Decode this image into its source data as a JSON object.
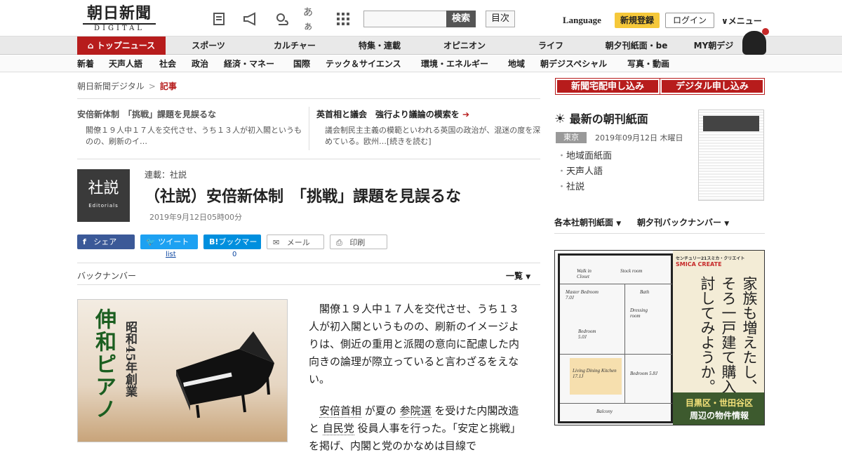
{
  "header": {
    "logo_main": "朝日新聞",
    "logo_sub": "DIGITAL",
    "search_button": "検索",
    "index_button": "目次",
    "language": "Language",
    "signup": "新規登録",
    "login": "ログイン",
    "menu": "∨メニュー",
    "icon_kana": "あぁ"
  },
  "nav_primary": {
    "items": [
      "トップニュース",
      "スポーツ",
      "カルチャー",
      "特集・連載",
      "オピニオン",
      "ライフ",
      "朝夕刊紙面・be",
      "MY朝デジ"
    ]
  },
  "nav_secondary": {
    "items": [
      "新着",
      "天声人語",
      "社会",
      "政治",
      "経済・マネー",
      "国際",
      "テック＆サイエンス",
      "環境・エネルギー",
      "地域",
      "朝デジスペシャル",
      "写真・動画"
    ]
  },
  "breadcrumb": {
    "home": "朝日新聞デジタル",
    "sep": ">",
    "current": "記事"
  },
  "related": [
    {
      "title": "安倍新体制　「挑戦」課題を見誤るな",
      "body": "閣僚１９人中１７人を交代させ、うち１３人が初入閣というものの、刷新のイ…"
    },
    {
      "title": "英首相と議会　強行より議論の模索を",
      "body": "議会制民主主義の模範といわれる英国の政治が、混迷の度を深めている。欧州…[続きを読む]"
    }
  ],
  "article": {
    "thumb_kanji": "社説",
    "thumb_en": "Editorials",
    "series": "連載：社説",
    "headline": "（社説）安倍新体制　「挑戦」課題を見誤るな",
    "date": "2019年9月12日05時00分",
    "share": {
      "facebook": "シェア",
      "twitter": "ツイート",
      "hatena": "ブックマーク",
      "hatena_logo": "B!",
      "mail": "メール",
      "print": "印刷",
      "twitter_count": "list",
      "hatena_count": "0"
    },
    "backnumber": "バックナンバー",
    "list_all": "一覧",
    "p1": "閣僚１９人中１７人を交代させ、うち１３人が初入閣というものの、刷新のイメージよりは、側近の重用と派閥の意向に配慮した内向きの論理が際立っていると言わざるをえない。",
    "p2_a": "安倍首相",
    "p2_b": "が夏の",
    "p2_c": "参院選",
    "p2_d": "を受けた内閣改造と",
    "p2_e": "自民党",
    "p2_f": "役員人事を行った。「安定と挑戦」を掲げ、内閣と党のかなめは目線で"
  },
  "ad_piano": {
    "name": "伸和ピアノ",
    "est": "昭和45年創業"
  },
  "sidebar": {
    "apply_home": "新聞宅配申し込み",
    "apply_digital": "デジタル申し込み",
    "paper_heading": "最新の朝刊紙面",
    "paper_place": "東京",
    "paper_date": "2019年09月12日 木曜日",
    "paper_links": [
      "地域面紙面",
      "天声人語",
      "社説"
    ],
    "sub_link1": "各本社朝刊紙面",
    "sub_link2": "朝夕刊バックナンバー"
  },
  "ad_realestate": {
    "brand": "センチュリー21スミカ・クリエイト",
    "logo": "SMICA CREATE",
    "copy": "家族も増えたし、そろそろ一戸建て購入を検討してみようか。",
    "area_a": "目黒区・世田谷区",
    "area_b": "周辺の物件情報",
    "rooms": [
      "Walk in Closet",
      "Stock room",
      "Master Bedroom 7.0J",
      "Bath",
      "Dressing room",
      "Bedroom 5.0J",
      "Living Dining Kitchen 17.1J",
      "Bedroom 5.8J",
      "Balcony"
    ]
  },
  "colors": {
    "brand_red": "#b71c1c",
    "signup_yellow": "#f5c83a",
    "facebook": "#3b5998",
    "twitter": "#1da1f2",
    "hatena": "#008fde"
  }
}
